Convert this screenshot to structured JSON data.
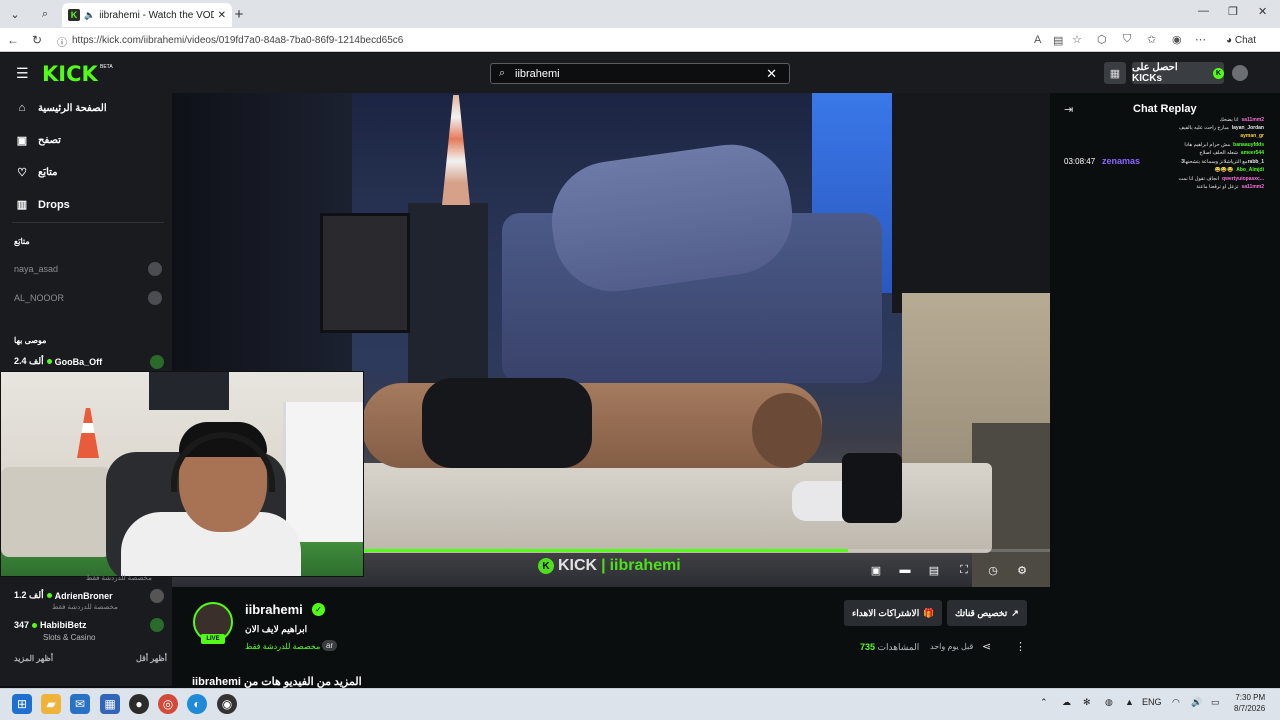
{
  "browser": {
    "tab_title": "iibrahemi - Watch the VOD o",
    "url": "https://kick.com/iibrahemi/videos/019fd7a0-84a8-7ba0-86f9-1214becd65c6",
    "chat_label": "Chat",
    "new_tab": "+",
    "icons": [
      "tab-list-icon",
      "search-icon",
      "back-icon",
      "reload-icon",
      "info-icon",
      "favorites-icon",
      "extensions-icon",
      "profile-icon",
      "settings-icon",
      "copilot-icon"
    ]
  },
  "header": {
    "logo": "KICK",
    "beta": "BETA",
    "search_value": "iibrahemi",
    "get_kicks": "احصل على KICKs"
  },
  "sidebar": {
    "nav": [
      {
        "label": "الصفحة الرئيسية",
        "icon": "home-icon"
      },
      {
        "label": "تصفح",
        "icon": "browse-icon"
      },
      {
        "label": "متابَع",
        "icon": "heart-icon"
      },
      {
        "label": "Drops",
        "icon": "drops-icon"
      }
    ],
    "following_heading": "متابَع",
    "following": [
      {
        "name": "naya_asad"
      },
      {
        "name": "AL_NOOOR"
      }
    ],
    "recommended_heading": "موصى بها",
    "recommended": [
      {
        "name": "GooBa_Off",
        "viewers": "2.4 ألف",
        "category": ""
      },
      {
        "name": "AdrienBroner",
        "viewers": "1.2 ألف",
        "category": "مخصصة للدردشة فقط"
      },
      {
        "name": "HabibiBetz",
        "viewers": "347",
        "category": "Slots & Casino"
      }
    ],
    "partial_category": "مخصصة للدردشة فقط",
    "show_more": "أظهر المزيد",
    "show_less": "أظهر أقل"
  },
  "video": {
    "watermark_brand": "KICK",
    "watermark_handle": "iibrahemi",
    "progress": 0.77,
    "controls": [
      "miniplayer-icon",
      "theater-icon",
      "clip-icon",
      "fullscreen-icon",
      "speed-icon",
      "settings-icon"
    ]
  },
  "channel": {
    "name": "iibrahemi",
    "live_badge": "LIVE",
    "stream_title": "ابراهيم لايف الان",
    "category": "مخصصة للدردشة فقط",
    "language": "ar",
    "subscriptions_button": "الاشتراكات الاهداء",
    "customize_button": "تخصيص قناتك",
    "views_label": "المشاهدات",
    "views": "735",
    "posted": "قبل يوم واحد",
    "description": "iibrahemi المزيد من الفيديو هات من"
  },
  "chat": {
    "title": "Chat Replay",
    "timestamp": "03:08:47",
    "highlight_user": "zenamas",
    "messages": [
      {
        "user": "sa11mm2",
        "text": "انا بضحك",
        "color": "#ff6de0"
      },
      {
        "user": "layan_Jordan",
        "text": "مبارح راحت عليه بالفيف",
        "color": "#e6e6e6"
      },
      {
        "user": "ayman_gr",
        "text": "",
        "color": "#ffcc33"
      },
      {
        "user": "banaauyfdds",
        "text": "مش حرام ابراهيم هادا",
        "color": "#53fc18"
      },
      {
        "user": "ameer544",
        "text": "شعله الحلف اصلاح",
        "color": "#53fc18"
      },
      {
        "user": "3rabb_1",
        "text": "مع الترياشلانز وسماعة بتشحنها",
        "color": "#e6e6e6"
      },
      {
        "user": "Abo_Almjdi",
        "text": "😂😂😂",
        "color": "#53fc18"
      },
      {
        "user": "qwertyuiopasxc...",
        "text": "انجاف تقول انا نمت",
        "color": "#ff6de0"
      },
      {
        "user": "sa11mm2",
        "text": "تزعل او ترقعنا ماعنة",
        "color": "#ff6de0"
      }
    ]
  },
  "taskbar": {
    "apps": [
      "start-icon",
      "file-explorer-icon",
      "outlook-icon",
      "calculator-icon",
      "obs-icon",
      "chrome-icon",
      "edge-icon",
      "app-icon"
    ],
    "language": "ENG",
    "time": "7:30 PM",
    "date": "8/7/2026"
  },
  "colors": {
    "accent": "#53fc18",
    "panel": "#191b1f",
    "background": "#0b0e0f"
  }
}
